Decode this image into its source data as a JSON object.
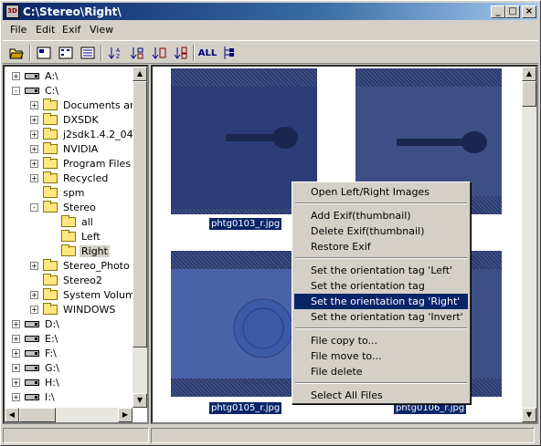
{
  "window": {
    "title": "C:\\Stereo\\Right\\",
    "app_icon_text": "3D"
  },
  "menubar": [
    {
      "label": "File"
    },
    {
      "label": "Edit"
    },
    {
      "label": "Exif"
    },
    {
      "label": "View"
    }
  ],
  "toolbar": {
    "all_label": "ALL"
  },
  "tree": [
    {
      "label": "A:\\",
      "type": "drive",
      "pm": "+",
      "indent": 0
    },
    {
      "label": "C:\\",
      "type": "drive",
      "pm": "-",
      "indent": 0
    },
    {
      "label": "Documents and",
      "type": "folder",
      "pm": "+",
      "indent": 1
    },
    {
      "label": "DXSDK",
      "type": "folder",
      "pm": "+",
      "indent": 1
    },
    {
      "label": "j2sdk1.4.2_04",
      "type": "folder",
      "pm": "+",
      "indent": 1
    },
    {
      "label": "NVIDIA",
      "type": "folder",
      "pm": "+",
      "indent": 1
    },
    {
      "label": "Program Files",
      "type": "folder",
      "pm": "+",
      "indent": 1
    },
    {
      "label": "Recycled",
      "type": "folder",
      "pm": "+",
      "indent": 1
    },
    {
      "label": "spm",
      "type": "folder",
      "pm": "",
      "indent": 1
    },
    {
      "label": "Stereo",
      "type": "folder",
      "pm": "-",
      "indent": 1
    },
    {
      "label": "all",
      "type": "folder",
      "pm": "",
      "indent": 2
    },
    {
      "label": "Left",
      "type": "folder",
      "pm": "",
      "indent": 2
    },
    {
      "label": "Right",
      "type": "folder-open",
      "pm": "",
      "indent": 2,
      "selected": true
    },
    {
      "label": "Stereo_Photo",
      "type": "folder",
      "pm": "+",
      "indent": 1
    },
    {
      "label": "Stereo2",
      "type": "folder",
      "pm": "",
      "indent": 1
    },
    {
      "label": "System Volume",
      "type": "folder",
      "pm": "+",
      "indent": 1
    },
    {
      "label": "WINDOWS",
      "type": "folder",
      "pm": "+",
      "indent": 1
    },
    {
      "label": "D:\\",
      "type": "drive",
      "pm": "+",
      "indent": 0
    },
    {
      "label": "E:\\",
      "type": "drive",
      "pm": "+",
      "indent": 0
    },
    {
      "label": "F:\\",
      "type": "drive",
      "pm": "+",
      "indent": 0
    },
    {
      "label": "G:\\",
      "type": "drive",
      "pm": "+",
      "indent": 0
    },
    {
      "label": "H:\\",
      "type": "drive",
      "pm": "+",
      "indent": 0
    },
    {
      "label": "I:\\",
      "type": "drive",
      "pm": "+",
      "indent": 0
    }
  ],
  "images": [
    {
      "caption": "phtg0103_r.jpg"
    },
    {
      "caption": ""
    },
    {
      "caption": "phtg0105_r.jpg"
    },
    {
      "caption": "phtg0106_r.jpg"
    }
  ],
  "context_menu": [
    {
      "label": "Open Left/Right Images"
    },
    {
      "sep": true
    },
    {
      "label": "Add Exif(thumbnail)"
    },
    {
      "label": "Delete Exif(thumbnail)"
    },
    {
      "label": "Restore Exif"
    },
    {
      "sep": true
    },
    {
      "label": "Set the orientation tag 'Left'"
    },
    {
      "label": "Set the orientation tag 'Original'"
    },
    {
      "label": "Set the orientation tag 'Right'",
      "highlighted": true
    },
    {
      "label": "Set the orientation tag 'Invert'"
    },
    {
      "sep": true
    },
    {
      "label": "File copy to..."
    },
    {
      "label": "File move to..."
    },
    {
      "label": "File delete"
    },
    {
      "sep": true
    },
    {
      "label": "Select All Files"
    }
  ],
  "colors": {
    "title_bar": "#0a246a",
    "selection": "#0a246a",
    "face": "#d4d0c8"
  }
}
